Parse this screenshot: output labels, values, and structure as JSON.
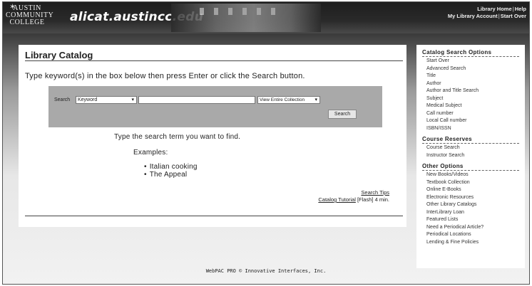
{
  "header": {
    "logo_lines": [
      "AUSTIN",
      "COMMUNITY",
      "COLLEGE"
    ],
    "site_title": "alicat.austincc.edu",
    "links_line1": [
      "Library Home",
      "Help"
    ],
    "links_line2": [
      "My Library Account",
      "Start Over"
    ]
  },
  "main": {
    "title": "Library Catalog",
    "instruction": "Type keyword(s) in the box below then press Enter or click the Search button.",
    "search": {
      "label": "Search",
      "type_selected": "Keyword",
      "input_value": "",
      "collection_selected": "View Entire Collection",
      "button_label": "Search"
    },
    "hint": "Type the search term you want to find.",
    "examples_label": "Examples:",
    "examples": [
      "Italian cooking",
      "The Appeal"
    ],
    "search_tips": "Search Tips",
    "tutorial_link": "Catalog Tutorial",
    "tutorial_suffix": " [Flash] 4 min."
  },
  "sidebar": {
    "sections": [
      {
        "heading": "Catalog Search Options",
        "items": [
          "Start Over",
          "Advanced Search",
          "Title",
          "Author",
          "Author and Title Search",
          "Subject",
          "Medical Subject",
          "Call number",
          "Local Call number",
          "ISBN/ISSN"
        ]
      },
      {
        "heading": "Course Reserves",
        "items": [
          "Course Search",
          "Instructor Search"
        ]
      },
      {
        "heading": "Other Options",
        "items": [
          "New Books/Videos",
          "Textbook Collection",
          "Online E-Books",
          "Electronic Resources",
          "Other Library Catalogs",
          "InterLibrary Loan",
          "Featured Lists",
          "Need a Periodical Article?",
          "Periodical Locations",
          "Lending & Fine Policies"
        ]
      }
    ]
  },
  "footer": "WebPAC PRO © Innovative Interfaces, Inc."
}
